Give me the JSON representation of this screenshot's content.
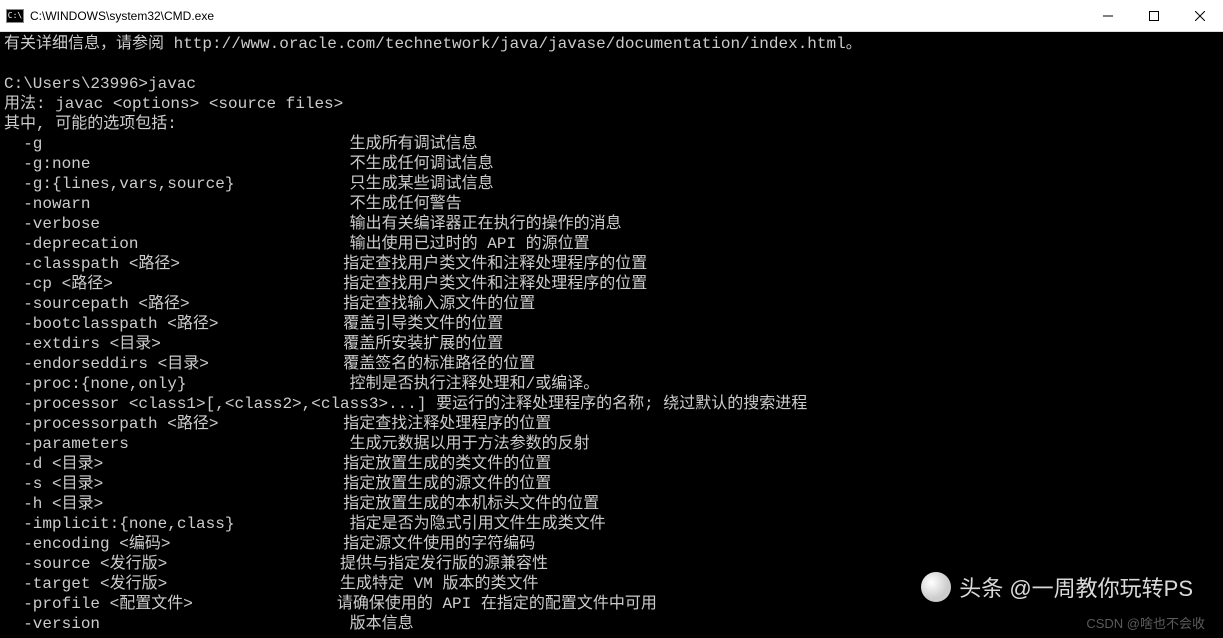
{
  "window": {
    "title": "C:\\WINDOWS\\system32\\CMD.exe",
    "icon_label": "C:\\"
  },
  "console": {
    "line_top": "有关详细信息，请参阅 http://www.oracle.com/technetwork/java/javase/documentation/index.html。",
    "prompt": "C:\\Users\\23996>javac",
    "usage": "用法: javac <options> <source files>",
    "options_header": "其中, 可能的选项包括:",
    "options": [
      {
        "flag": "-g",
        "desc": "生成所有调试信息"
      },
      {
        "flag": "-g:none",
        "desc": "不生成任何调试信息"
      },
      {
        "flag": "-g:{lines,vars,source}",
        "desc": "只生成某些调试信息"
      },
      {
        "flag": "-nowarn",
        "desc": "不生成任何警告"
      },
      {
        "flag": "-verbose",
        "desc": "输出有关编译器正在执行的操作的消息"
      },
      {
        "flag": "-deprecation",
        "desc": "输出使用已过时的 API 的源位置"
      },
      {
        "flag": "-classpath <路径>",
        "desc": "指定查找用户类文件和注释处理程序的位置"
      },
      {
        "flag": "-cp <路径>",
        "desc": "指定查找用户类文件和注释处理程序的位置"
      },
      {
        "flag": "-sourcepath <路径>",
        "desc": "指定查找输入源文件的位置"
      },
      {
        "flag": "-bootclasspath <路径>",
        "desc": "覆盖引导类文件的位置"
      },
      {
        "flag": "-extdirs <目录>",
        "desc": "覆盖所安装扩展的位置"
      },
      {
        "flag": "-endorseddirs <目录>",
        "desc": "覆盖签名的标准路径的位置"
      },
      {
        "flag": "-proc:{none,only}",
        "desc": "控制是否执行注释处理和/或编译。"
      },
      {
        "flag": "-processor <class1>[,<class2>,<class3>...] 要运行的注释处理程序的名称; 绕过默认的搜索进程",
        "desc": ""
      },
      {
        "flag": "-processorpath <路径>",
        "desc": "指定查找注释处理程序的位置"
      },
      {
        "flag": "-parameters",
        "desc": "生成元数据以用于方法参数的反射"
      },
      {
        "flag": "-d <目录>",
        "desc": "指定放置生成的类文件的位置"
      },
      {
        "flag": "-s <目录>",
        "desc": "指定放置生成的源文件的位置"
      },
      {
        "flag": "-h <目录>",
        "desc": "指定放置生成的本机标头文件的位置"
      },
      {
        "flag": "-implicit:{none,class}",
        "desc": "指定是否为隐式引用文件生成类文件"
      },
      {
        "flag": "-encoding <编码>",
        "desc": "指定源文件使用的字符编码"
      },
      {
        "flag": "-source <发行版>",
        "desc": "提供与指定发行版的源兼容性"
      },
      {
        "flag": "-target <发行版>",
        "desc": "生成特定 VM 版本的类文件"
      },
      {
        "flag": "-profile <配置文件>",
        "desc": "请确保使用的 API 在指定的配置文件中可用"
      },
      {
        "flag": "-version",
        "desc": "版本信息"
      }
    ]
  },
  "watermarks": {
    "main": "头条 @一周教你玩转PS",
    "sub": "CSDN @啥也不会收"
  }
}
